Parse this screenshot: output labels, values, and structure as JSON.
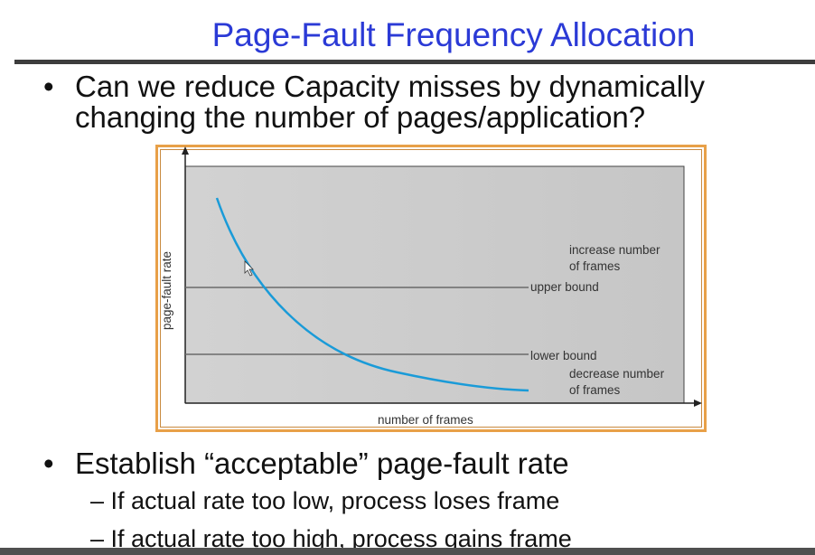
{
  "slide": {
    "title": "Page-Fault Frequency Allocation",
    "bullet_symbol": "•",
    "bullet1": {
      "line1": "Can we reduce Capacity misses by dynamically",
      "line2": "changing the number of pages/application?"
    },
    "bullet2": {
      "text": "Establish “acceptable” page-fault rate",
      "sub1": "– If actual rate too low, process loses frame",
      "sub2": "– If actual rate too high, process gains frame"
    }
  },
  "diagram": {
    "y_axis_label": "page-fault rate",
    "x_axis_label": "number of frames",
    "upper_bound_label": "upper bound",
    "lower_bound_label": "lower bound",
    "increase_label_line1": "increase number",
    "increase_label_line2": "of frames",
    "decrease_label_line1": "decrease number",
    "decrease_label_line2": "of frames",
    "colors": {
      "curve": "#1a9bd8",
      "plot_background": "#cccccc",
      "frame_border": "#e8a048",
      "title": "#2b3ad6"
    }
  }
}
